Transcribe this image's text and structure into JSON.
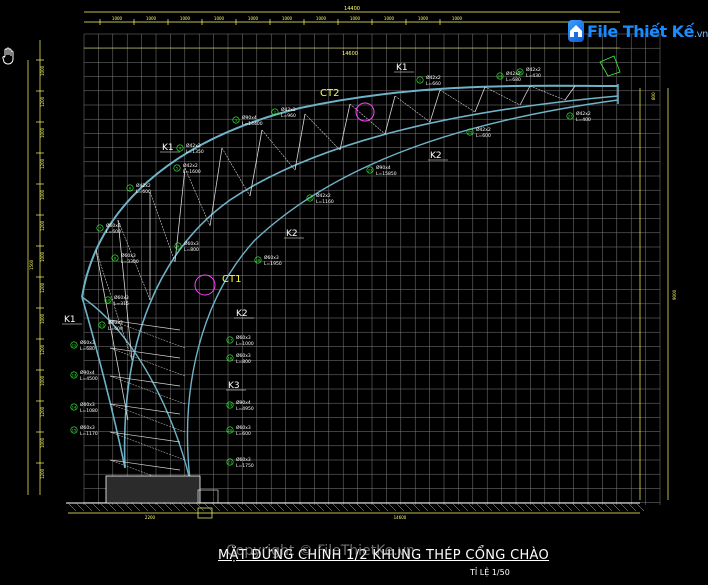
{
  "logo": {
    "brand": "File Thiết Kế",
    "suffix": ".vn"
  },
  "watermark": "Copyright © FileThietKe.vn",
  "drawing": {
    "title": "MẶT ĐỨNG CHÍNH 1/2 KHUNG THÉP CỔNG CHÀO",
    "scale": "TỈ LỆ 1/50",
    "colors": {
      "grid": "#7f7f7f",
      "arch": "#6fb3c8",
      "truss": "#d8d8d8",
      "label": "#33ff33",
      "text": "#ffffff",
      "accent": "#ff44ff",
      "callout": "#ffff33",
      "dim": "#ffff66"
    },
    "section_labels": [
      "K1",
      "K1",
      "K2",
      "K2",
      "K2",
      "K3",
      "K1"
    ],
    "detail_labels": [
      "CT1",
      "CT2"
    ],
    "members": [
      {
        "id": "1",
        "spec": "Ø42x2",
        "length": "L=660"
      },
      {
        "id": "2",
        "spec": "Ø42x2",
        "length": "L=960"
      },
      {
        "id": "3",
        "spec": "Ø90x4",
        "length": "L=14400"
      },
      {
        "id": "4",
        "spec": "Ø42x2",
        "length": "L=1350"
      },
      {
        "id": "5",
        "spec": "Ø42x2",
        "length": "L=1600"
      },
      {
        "id": "6",
        "spec": "Ø42x2",
        "length": "L=600"
      },
      {
        "id": "7",
        "spec": "Ø60x3",
        "length": "L=600"
      },
      {
        "id": "8",
        "spec": "Ø60x3",
        "length": "L=3300"
      },
      {
        "id": "9",
        "spec": "Ø60x3",
        "length": "L=800"
      },
      {
        "id": "10",
        "spec": "Ø60x3",
        "length": "L=315"
      },
      {
        "id": "11",
        "spec": "Ø60x3",
        "length": "L=600"
      },
      {
        "id": "12",
        "spec": "Ø60x3",
        "length": "L=680"
      },
      {
        "id": "13",
        "spec": "Ø90x4",
        "length": "L=4500"
      },
      {
        "id": "14",
        "spec": "Ø60x3",
        "length": "L=1080"
      },
      {
        "id": "15",
        "spec": "Ø60x3",
        "length": "L=1170"
      },
      {
        "id": "16",
        "spec": "Ø60x3",
        "length": "L=1950"
      },
      {
        "id": "17",
        "spec": "Ø60x3",
        "length": "L=1000"
      },
      {
        "id": "18",
        "spec": "Ø60x3",
        "length": "L=800"
      },
      {
        "id": "19",
        "spec": "Ø90x4",
        "length": "L=4950"
      },
      {
        "id": "20",
        "spec": "Ø60x3",
        "length": "L=600"
      },
      {
        "id": "21",
        "spec": "Ø60x3",
        "length": "L=1750"
      },
      {
        "id": "22",
        "spec": "Ø42x2",
        "length": "L=1160"
      },
      {
        "id": "23",
        "spec": "Ø90x4",
        "length": "L=15850"
      },
      {
        "id": "24",
        "spec": "Ø42x2",
        "length": "L=680"
      },
      {
        "id": "25",
        "spec": "Ø42x2",
        "length": "L=600"
      },
      {
        "id": "26",
        "spec": "Ø42x2",
        "length": "L=430"
      },
      {
        "id": "27",
        "spec": "Ø42x2",
        "length": "L=400"
      }
    ],
    "dimensions_top": [
      "14400",
      "1000",
      "14600"
    ],
    "dimensions_bottom": [
      "2200",
      "14600"
    ],
    "dimensions_left": [
      "1000",
      "1200",
      "1000",
      "1200"
    ],
    "dimensions_right": [
      "800",
      "9000"
    ]
  }
}
